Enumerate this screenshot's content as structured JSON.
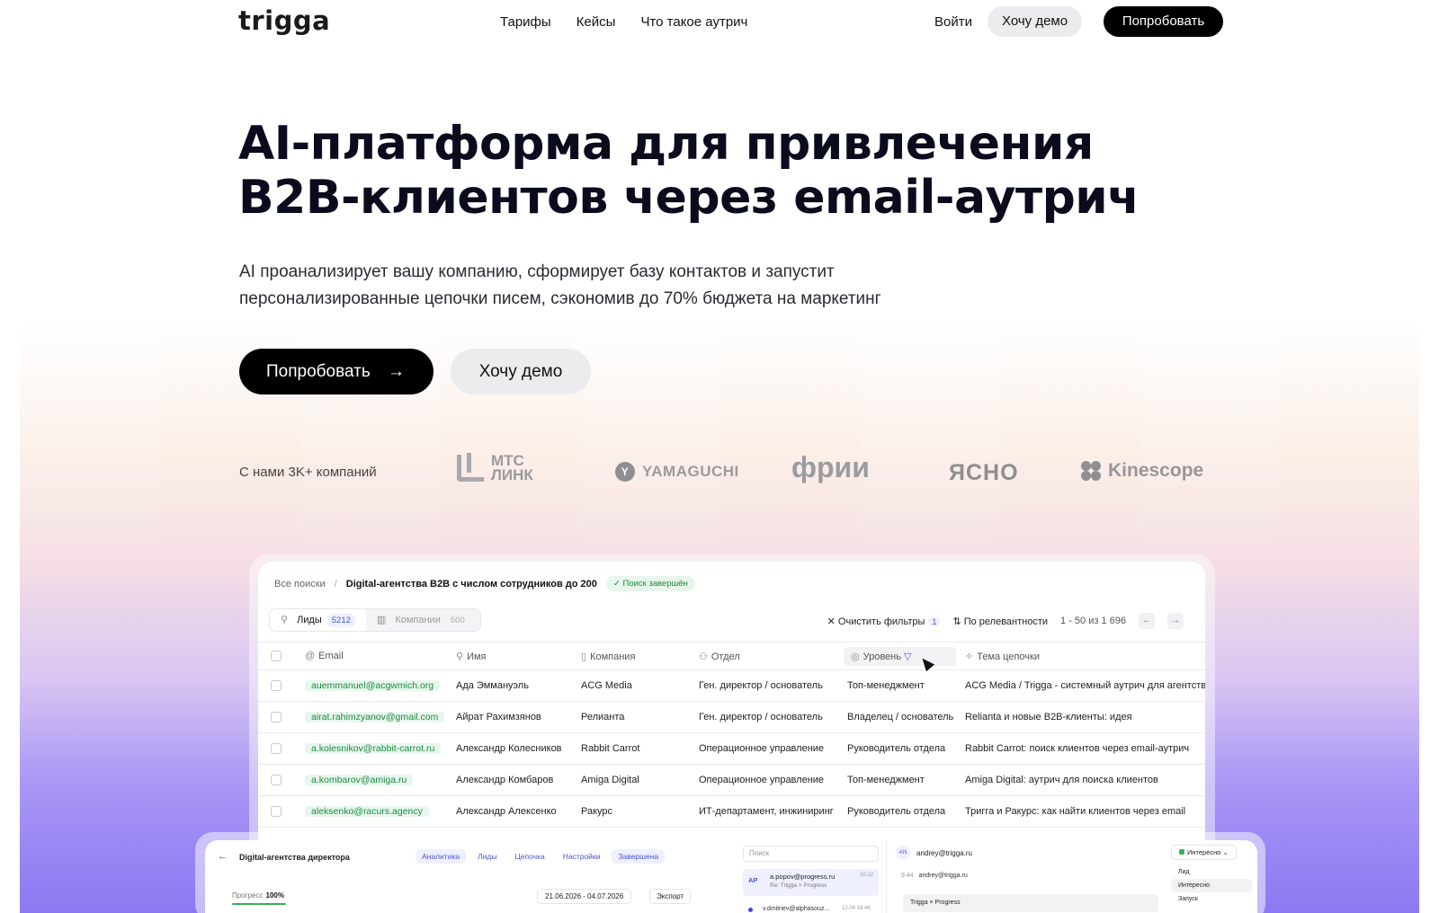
{
  "brand": {
    "logo": "trigga"
  },
  "nav": {
    "items": [
      "Тарифы",
      "Кейсы",
      "Что такое аутрич"
    ],
    "login": "Войти",
    "demo": "Хочу демо",
    "try": "Попробовать"
  },
  "hero": {
    "title_line1": "AI-платформа для привлечения",
    "title_line2": "B2B-клиентов через email-аутрич",
    "subtitle_line1": "AI проанализирует вашу компанию, сформирует базу контактов и запустит",
    "subtitle_line2": "персонализированные цепочки писем, сэкономив до 70% бюджета на маркетинг",
    "try_button": "Попробовать",
    "try_arrow": "→",
    "demo_button": "Хочу демо"
  },
  "clients": {
    "label": "С нами 3K+ компаний",
    "logos": {
      "mts_line1": "МТС",
      "mts_line2": "ЛИНК",
      "yamaguchi": "YAMAGUCHI",
      "friy": "фрии",
      "yasno": "ЯСНО",
      "kinescope": "Kinescope"
    }
  },
  "app": {
    "breadcrumb": {
      "root": "Все поиски",
      "separator": "/",
      "current": "Digital-агентства B2B с числом сотрудников до 200",
      "status": "✓ Поиск завершён"
    },
    "tabs": [
      {
        "label": "Лиды",
        "count": "5212",
        "icon": "user-icon"
      },
      {
        "label": "Компании",
        "count": "500",
        "icon": "building-icon"
      }
    ],
    "toolbar": {
      "clear_filters": "Очистить фильтры",
      "filters_count": "1",
      "sort": "По релевантности",
      "pager": "1 - 50  из 1 696",
      "prev": "←",
      "next": "→"
    },
    "columns": [
      "Email",
      "Имя",
      "Компания",
      "Отдел",
      "Уровень",
      "Тема цепочки"
    ],
    "rows": [
      {
        "email": "auemmanuel@acgwmich.org",
        "name": "Ада Эммануэль",
        "company": "ACG Media",
        "dept": "Ген. директор / основатель",
        "level": "Топ-менеджмент",
        "topic": "ACG Media / Trigga - системный аутрич для агентства"
      },
      {
        "email": "airat.rahimzyanov@gmail.com",
        "name": "Айрат Рахимзянов",
        "company": "Релианта",
        "dept": "Ген. директор / основатель",
        "level": "Владелец / основатель",
        "topic": "Relianta и новые B2B-клиенты: идея"
      },
      {
        "email": "a.kolesnikov@rabbit-carrot.ru",
        "name": "Александр Колесников",
        "company": "Rabbit Carrot",
        "dept": "Операционное управление",
        "level": "Руководитель отдела",
        "topic": "Rabbit Carrot: поиск клиентов через email-аутрич"
      },
      {
        "email": "a.kombarov@amiga.ru",
        "name": "Александр Комбаров",
        "company": "Amiga Digital",
        "dept": "Операционное управление",
        "level": "Топ-менеджмент",
        "topic": "Amiga Digital: аутрич для поиска клиентов"
      },
      {
        "email": "aleksenko@racurs.agency",
        "name": "Александр Алексенко",
        "company": "Ракурс",
        "dept": "ИТ-департамент, инжиниринг",
        "level": "Руководитель отдела",
        "topic": "Тригга и Ракурс: как найти клиентов через email"
      }
    ]
  },
  "campaign_panel": {
    "back": "←",
    "title": "Digital-агентства директора",
    "tabs": [
      "Аналитика",
      "Лиды",
      "Цепочка",
      "Настройки",
      "Завершена"
    ],
    "progress_label": "Прогресс",
    "progress_value": "100%",
    "progress": 1.0,
    "dates": "21.06.2026 - 04.07.2026",
    "export": "Экспорт"
  },
  "inbox_panel": {
    "search_placeholder": "Поиск",
    "message": {
      "avatar": "AP",
      "from": "a.popov@progress.ru",
      "re": "Re: Trigga × Progress",
      "time": "10:22"
    },
    "message2": {
      "from": "v.dmitriev@alphasouz...",
      "time": "12.04 18:46"
    },
    "thread_avatar": "AN",
    "thread_email": "andrey@trigga.ru",
    "status": "Интересно",
    "thread_time": "9:44",
    "thread_from": "andrey@trigga.ru",
    "bubble": "Trigga × Progress",
    "dropdown": [
      "Лид",
      "Интересно",
      "Запуск"
    ]
  },
  "colors": {
    "accent": "#4a56c9",
    "success": "#1d8a41",
    "black_button": "#000000",
    "gradient_bottom": "#8d78f2"
  }
}
